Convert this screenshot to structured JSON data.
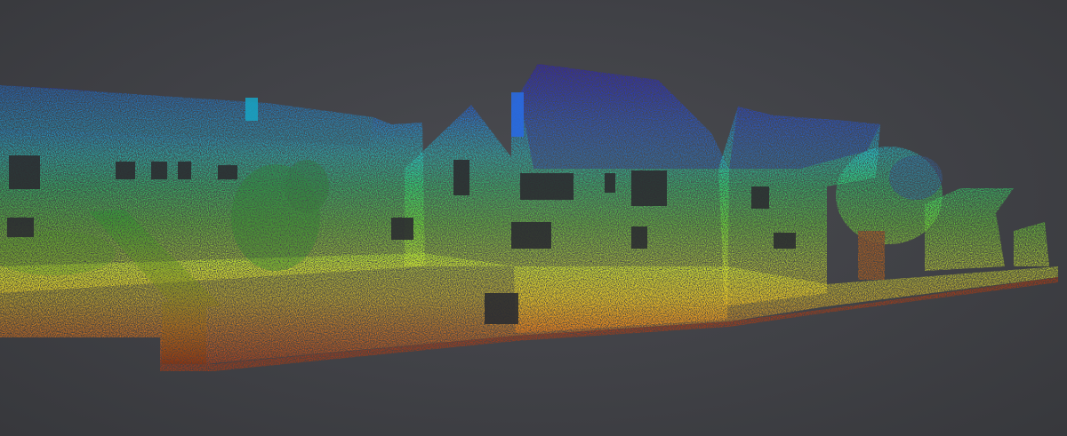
{
  "scene": {
    "background_color": "#3f4045",
    "colormap": {
      "name": "elevation-rainbow",
      "stops": [
        {
          "offset": 0.0,
          "color": "#2a00c8"
        },
        {
          "offset": 0.18,
          "color": "#1a6cff"
        },
        {
          "offset": 0.32,
          "color": "#22d0e8"
        },
        {
          "offset": 0.48,
          "color": "#34e060"
        },
        {
          "offset": 0.62,
          "color": "#8ee830"
        },
        {
          "offset": 0.74,
          "color": "#f0f030"
        },
        {
          "offset": 0.86,
          "color": "#ff9a18"
        },
        {
          "offset": 1.0,
          "color": "#e83210"
        }
      ]
    },
    "subject": "point-cloud-street-facade"
  }
}
